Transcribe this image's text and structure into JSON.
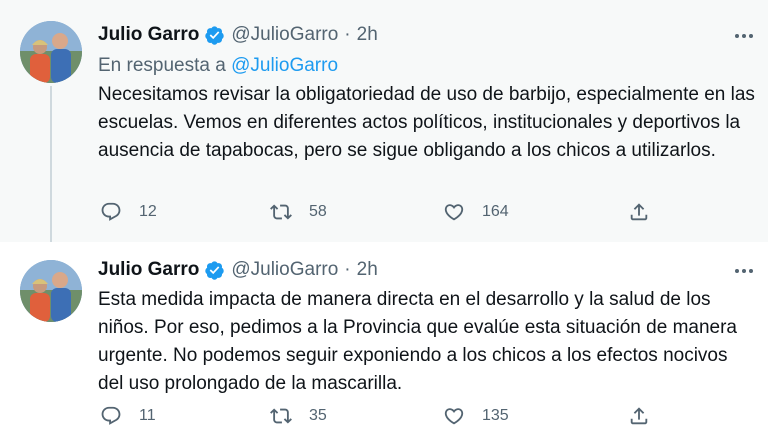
{
  "tweets": [
    {
      "author_name": "Julio Garro",
      "author_handle": "@JulioGarro",
      "separator": "·",
      "time": "2h",
      "reply_prefix": "En respuesta a",
      "reply_handle": "@JulioGarro",
      "text": "Necesitamos revisar la obligatoriedad de uso de barbijo, especialmente en las escuelas. Vemos en diferentes actos políticos, institucionales y deportivos la ausencia de tapabocas, pero se sigue obligando a los chicos a utilizarlos.",
      "replies": "12",
      "retweets": "58",
      "likes": "164"
    },
    {
      "author_name": "Julio Garro",
      "author_handle": "@JulioGarro",
      "separator": "·",
      "time": "2h",
      "text": "Esta medida impacta de manera directa en el desarrollo y la salud de los niños. Por eso, pedimos a la Provincia que evalúe esta situación de manera urgente. No podemos seguir exponiendo a los chicos a los efectos nocivos del uso prolongado de la mascarilla.",
      "replies": "11",
      "retweets": "35",
      "likes": "135"
    }
  ],
  "icons": {
    "verified": "verified-badge-icon",
    "more": "more-options-icon",
    "reply": "reply-icon",
    "retweet": "retweet-icon",
    "like": "like-icon",
    "share": "share-icon"
  },
  "colors": {
    "accent": "#1d9bf0",
    "secondary_text": "#536471",
    "primary_text": "#0f1419"
  }
}
